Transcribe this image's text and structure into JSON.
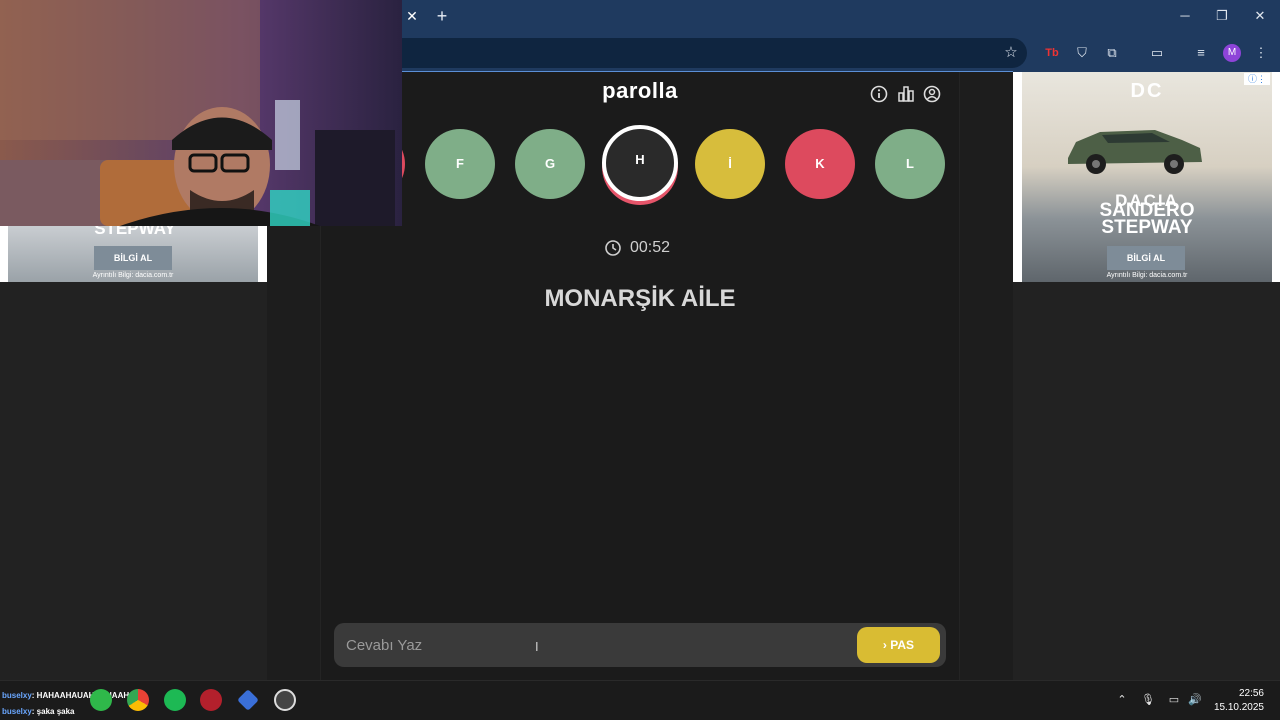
{
  "browser": {
    "tab_close": "✕",
    "new_tab": "+",
    "window_controls": [
      "─",
      "❐",
      "✕"
    ],
    "profile_initial": "M"
  },
  "game": {
    "brand": "parolla",
    "header_icons": [
      "info-icon",
      "stats-icon",
      "user-icon"
    ],
    "letters": [
      {
        "label": "F",
        "state": "green"
      },
      {
        "label": "G",
        "state": "green"
      },
      {
        "label": "H",
        "state": "current"
      },
      {
        "label": "İ",
        "state": "yellow"
      },
      {
        "label": "K",
        "state": "red"
      },
      {
        "label": "L",
        "state": "green"
      }
    ],
    "timer": "00:52",
    "question": "MONARŞİK AİLE",
    "answer_placeholder": "Cevabı Yaz",
    "pas_label": "PAS"
  },
  "ads": {
    "left": {
      "title": "STEPWAY",
      "button": "BİLGİ AL",
      "note": "Ayrıntılı Bilgi: dacia.com.tr"
    },
    "right": {
      "logo": "DC",
      "line1": "DACIA",
      "line2": "SANDERO",
      "line3": "STEPWAY",
      "button": "BİLGİ AL",
      "note": "Ayrıntılı Bilgi: dacia.com.tr"
    }
  },
  "taskbar": {
    "chat": [
      {
        "user": "buselxy",
        "message": ": HAHAAHAUAHAAUAAHAJ"
      },
      {
        "user": "buselxy",
        "message": ": şaka şaka"
      }
    ],
    "time": "22:56",
    "date": "15.10.2025"
  },
  "colors": {
    "green": "#7fae88",
    "yellow": "#d7bd3c",
    "red": "#dd4a5e",
    "pas": "#d9bc33",
    "chrome": "#1f3a5f"
  }
}
